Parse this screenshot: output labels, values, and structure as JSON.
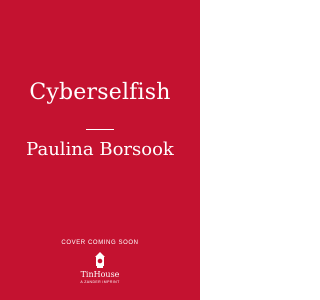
{
  "cover": {
    "background_color": "#c41230",
    "text_color": "#ffffff",
    "title": "Cyberselfish",
    "author": "Paulina Borsook",
    "status": "COVER COMING SOON",
    "publisher": {
      "logo_icon": "tin-house-logo-icon",
      "name": "TinHouse",
      "imprint": "A ZANDER IMPRINT"
    }
  }
}
